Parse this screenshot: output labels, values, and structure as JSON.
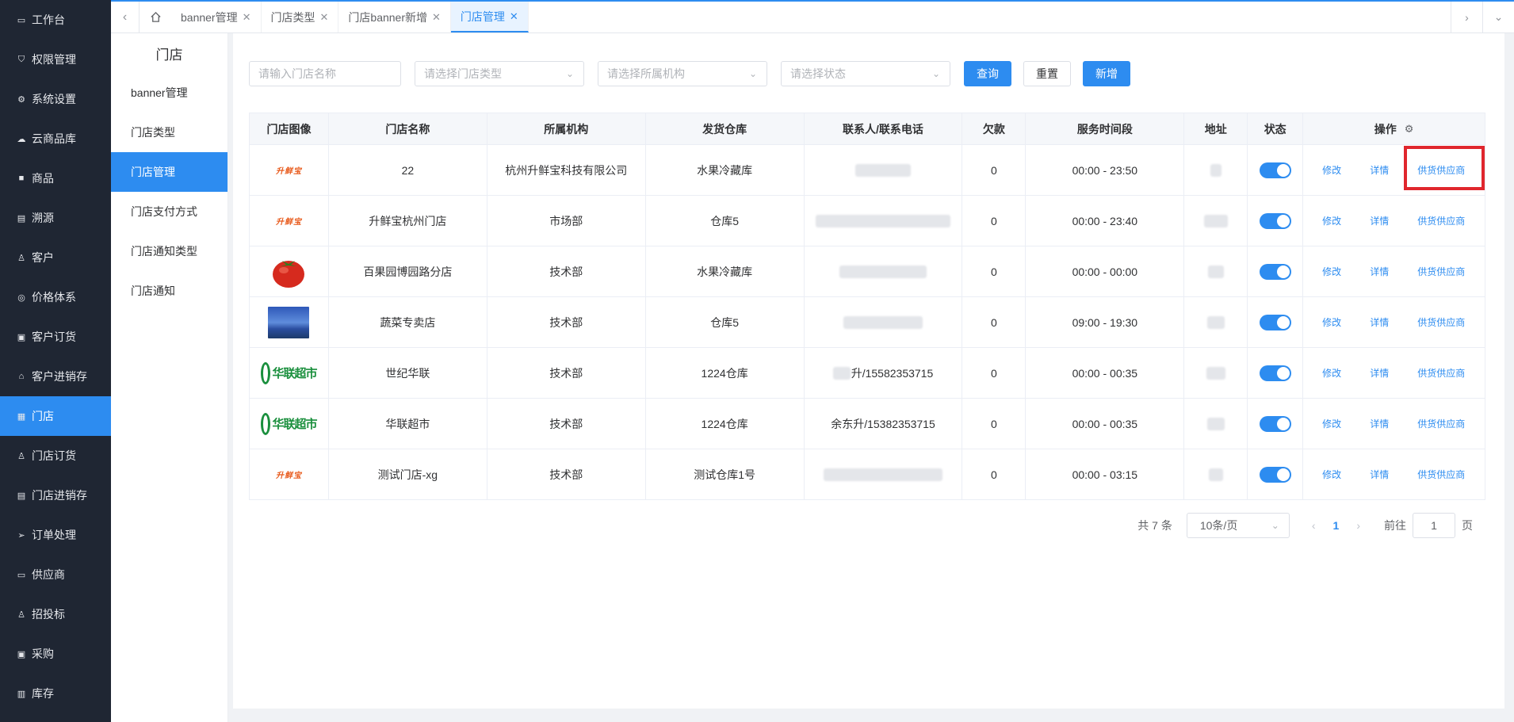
{
  "sidebar": {
    "items": [
      {
        "label": "工作台",
        "icon": "monitor-icon"
      },
      {
        "label": "权限管理",
        "icon": "shield-icon"
      },
      {
        "label": "系统设置",
        "icon": "gear-icon"
      },
      {
        "label": "云商品库",
        "icon": "cloud-icon"
      },
      {
        "label": "商品",
        "icon": "goods-icon"
      },
      {
        "label": "溯源",
        "icon": "trace-icon"
      },
      {
        "label": "客户",
        "icon": "user-icon"
      },
      {
        "label": "价格体系",
        "icon": "price-icon"
      },
      {
        "label": "客户订货",
        "icon": "order-icon"
      },
      {
        "label": "客户进销存",
        "icon": "home-icon"
      },
      {
        "label": "门店",
        "icon": "store-icon"
      },
      {
        "label": "门店订货",
        "icon": "store-order-icon"
      },
      {
        "label": "门店进销存",
        "icon": "inventory-icon"
      },
      {
        "label": "订单处理",
        "icon": "send-icon"
      },
      {
        "label": "供应商",
        "icon": "supplier-icon"
      },
      {
        "label": "招投标",
        "icon": "bid-icon"
      },
      {
        "label": "采购",
        "icon": "purchase-icon"
      },
      {
        "label": "库存",
        "icon": "stock-icon"
      }
    ],
    "active_index": 10
  },
  "tabs": [
    {
      "label": "banner管理"
    },
    {
      "label": "门店类型"
    },
    {
      "label": "门店banner新增"
    },
    {
      "label": "门店管理"
    }
  ],
  "subsidebar": {
    "title": "门店",
    "items": [
      {
        "label": "banner管理"
      },
      {
        "label": "门店类型"
      },
      {
        "label": "门店管理"
      },
      {
        "label": "门店支付方式"
      },
      {
        "label": "门店通知类型"
      },
      {
        "label": "门店通知"
      }
    ]
  },
  "filters": {
    "name_placeholder": "请输入门店名称",
    "type_placeholder": "请选择门店类型",
    "org_placeholder": "请选择所属机构",
    "status_placeholder": "请选择状态",
    "query_label": "查询",
    "reset_label": "重置",
    "add_label": "新增"
  },
  "table": {
    "headers": [
      "门店图像",
      "门店名称",
      "所属机构",
      "发货仓库",
      "联系人/联系电话",
      "欠款",
      "服务时间段",
      "地址",
      "状态",
      "操作"
    ],
    "ops": {
      "edit": "修改",
      "detail": "详情",
      "supplier": "供货供应商"
    },
    "rows": [
      {
        "logo": "升鲜宝",
        "name": "22",
        "org": "杭州升鲜宝科技有限公司",
        "warehouse": "水果冷藏库",
        "contact": "",
        "debt": "0",
        "time": "00:00 - 23:50"
      },
      {
        "logo": "升鲜宝",
        "name": "升鲜宝杭州门店",
        "org": "市场部",
        "warehouse": "仓库5",
        "contact": "",
        "debt": "0",
        "time": "00:00 - 23:40"
      },
      {
        "logo": "",
        "name": "百果园博园路分店",
        "org": "技术部",
        "warehouse": "水果冷藏库",
        "contact": "",
        "debt": "0",
        "time": "00:00 - 00:00"
      },
      {
        "logo": "",
        "name": "蔬菜专卖店",
        "org": "技术部",
        "warehouse": "仓库5",
        "contact": "",
        "debt": "0",
        "time": "09:00 - 19:30"
      },
      {
        "logo": "华联超市",
        "name": "世纪华联",
        "org": "技术部",
        "warehouse": "1224仓库",
        "contact": "升/15582353715",
        "debt": "0",
        "time": "00:00 - 00:35"
      },
      {
        "logo": "华联超市",
        "name": "华联超市",
        "org": "技术部",
        "warehouse": "1224仓库",
        "contact": "余东升/15382353715",
        "debt": "0",
        "time": "00:00 - 00:35"
      },
      {
        "logo": "升鲜宝",
        "name": "测试门店-xg",
        "org": "技术部",
        "warehouse": "测试仓库1号",
        "contact": "",
        "debt": "0",
        "time": "00:00 - 03:15"
      }
    ]
  },
  "pagination": {
    "total": "共 7 条",
    "page_size": "10条/页",
    "current": "1",
    "goto_label": "前往",
    "goto_value": "1",
    "page_unit": "页"
  },
  "colors": {
    "primary": "#2d8cf0",
    "sidebar": "#1f2633",
    "highlight_box": "#e0262d"
  }
}
